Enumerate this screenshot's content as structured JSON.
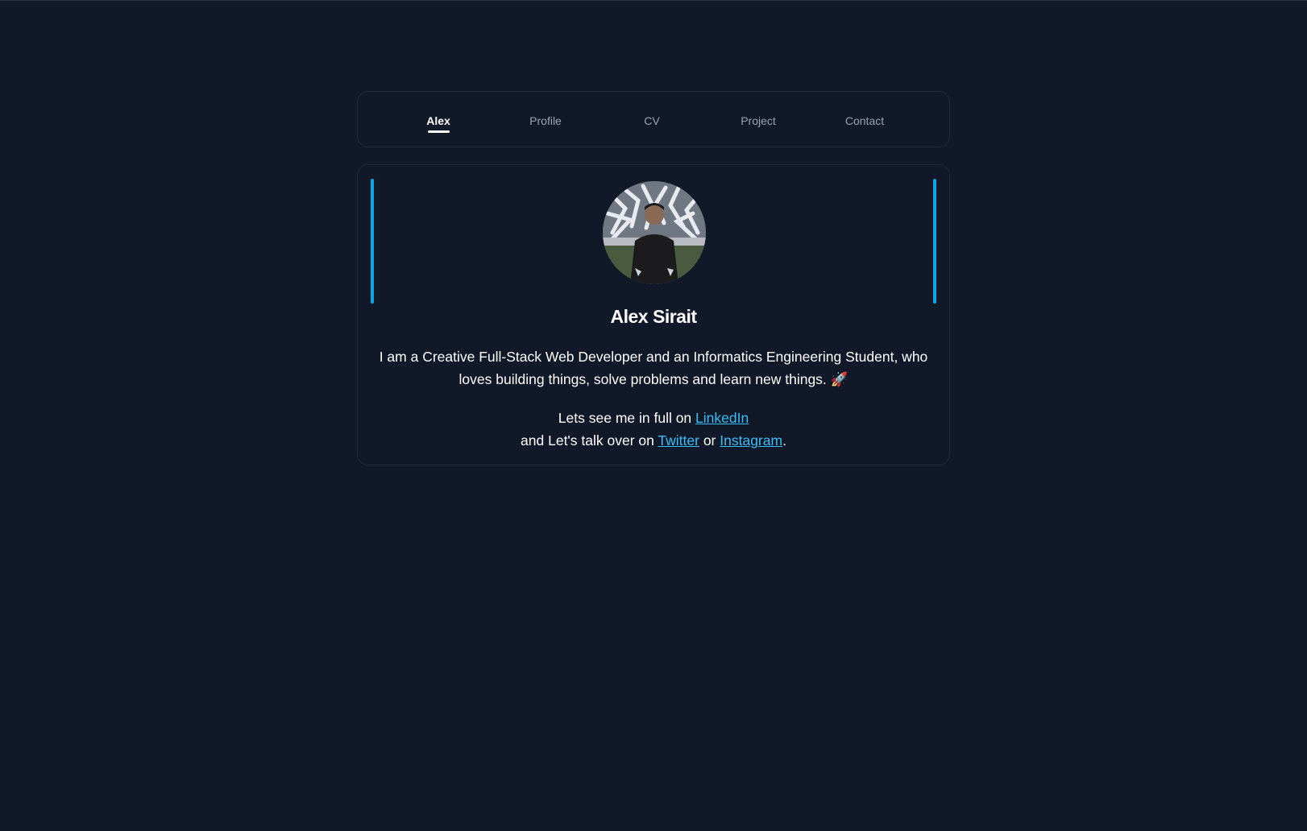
{
  "nav": {
    "items": [
      {
        "label": "Alex",
        "active": true
      },
      {
        "label": "Profile"
      },
      {
        "label": "CV"
      },
      {
        "label": "Project"
      },
      {
        "label": "Contact"
      }
    ]
  },
  "profile": {
    "avatar_alt": "avatar",
    "name": "Alex Sirait",
    "bio": "I am a Creative Full-Stack Web Developer and an Informatics Engineering Student, who loves building things, solve problems and learn new things. 🚀",
    "linkedin_prefix": "Lets see me in full on ",
    "linkedin_label": "LinkedIn",
    "talk_prefix": "and Let's talk over on ",
    "twitter_label": "Twitter",
    "or_text": " or ",
    "instagram_label": "Instagram",
    "end_text": "."
  },
  "colors": {
    "background": "#111827",
    "accent": "#0ea5e9",
    "link": "#38bdf8",
    "muted_text": "#9ca3af"
  }
}
